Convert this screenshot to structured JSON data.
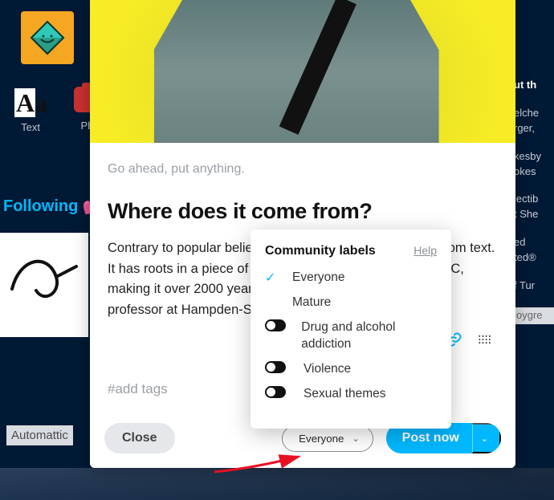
{
  "sidebar": {
    "text_label": "Text",
    "photo_label": "Pho",
    "following_label": "Following 💕"
  },
  "right_fragments": {
    "f0": "ut th",
    "f1": "elche",
    "f2": "rger,",
    "f3": "kesby",
    "f4": "okes",
    "f5": "lectib",
    "f6": "t She",
    "f7": "ed",
    "f8": "ted®",
    "f9": "f Tur",
    "f10": "oygre"
  },
  "footer": {
    "automattic": "Automattic"
  },
  "composer": {
    "prompt": "Go ahead, put anything.",
    "title": "Where does it come from?",
    "body": "Contrary to popular belief, Lorem Ipsum is not simply random text. It has roots in a piece of classical Latin literature from 45 BC, making it over 2000 years old. Richard McClintock, a Latin professor at Hampden-Sydney College",
    "tags_placeholder": "#add tags",
    "close_label": "Close",
    "label_select": "Everyone",
    "post_label": "Post now"
  },
  "popover": {
    "title": "Community labels",
    "help": "Help",
    "everyone": "Everyone",
    "mature": "Mature",
    "drug": "Drug and alcohol addiction",
    "violence": "Violence",
    "sexual": "Sexual themes"
  },
  "colors": {
    "accent": "#00b8ff",
    "bg": "#001935",
    "hero": "#f7ec25"
  }
}
